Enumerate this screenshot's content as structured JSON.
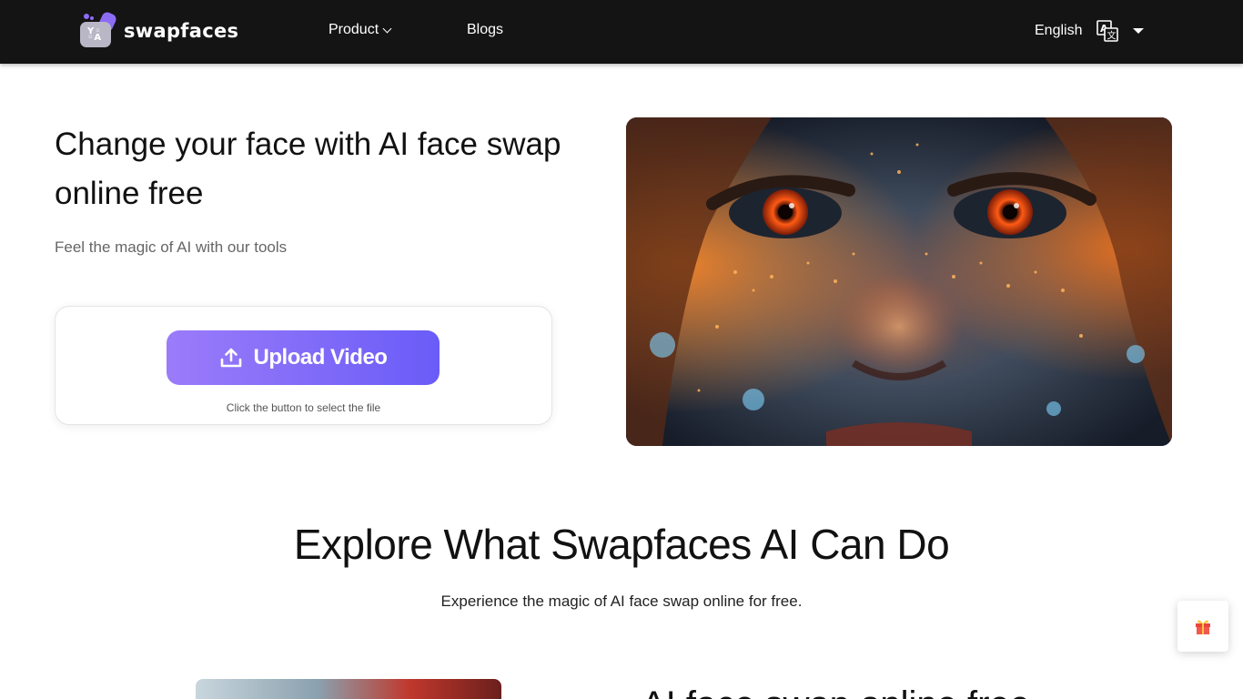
{
  "nav": {
    "brand": "swapfaces",
    "product_label": "Product",
    "blogs_label": "Blogs",
    "language_label": "English"
  },
  "hero": {
    "title": "Change your face with AI face swap online free",
    "subtitle": "Feel the magic of AI with our tools",
    "upload_label": "Upload Video",
    "upload_hint": "Click the button to select the file"
  },
  "explore": {
    "title": "Explore What Swapfaces AI Can Do",
    "subtitle": "Experience the magic of AI face swap online for free.",
    "next_heading": "AI face swap online free"
  },
  "colors": {
    "nav_bg": "#141414",
    "accent_start": "#9b7cf9",
    "accent_end": "#6a5cf8"
  },
  "icons": {
    "language": "translate-icon",
    "upload": "upload-icon",
    "gift": "gift-icon"
  }
}
